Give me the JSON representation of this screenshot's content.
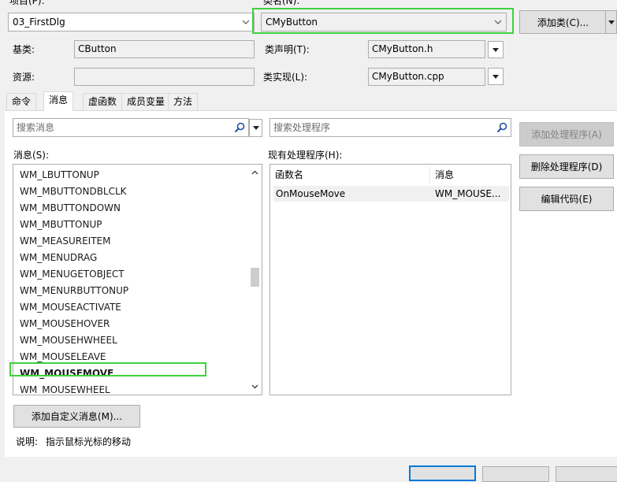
{
  "top": {
    "project_label": "项目(P):",
    "project_value": "03_FirstDlg",
    "class_name_label": "类名(N):",
    "class_name_value": "CMyButton",
    "add_class_label": "添加类(C)...",
    "base_class_label": "基类:",
    "base_class_value": "CButton",
    "class_decl_label": "类声明(T):",
    "class_decl_value": "CMyButton.h",
    "resource_label": "资源:",
    "resource_value": "",
    "class_impl_label": "类实现(L):",
    "class_impl_value": "CMyButton.cpp"
  },
  "tabs": [
    {
      "label": "命令"
    },
    {
      "label": "消息",
      "active": true
    },
    {
      "label": "虚函数"
    },
    {
      "label": "成员变量"
    },
    {
      "label": "方法"
    }
  ],
  "messages_panel": {
    "search_placeholder": "搜索消息",
    "list_label": "消息(S):",
    "items": [
      "WM_LBUTTONUP",
      "WM_MBUTTONDBLCLK",
      "WM_MBUTTONDOWN",
      "WM_MBUTTONUP",
      "WM_MEASUREITEM",
      "WM_MENUDRAG",
      "WM_MENUGETOBJECT",
      "WM_MENURBUTTONUP",
      "WM_MOUSEACTIVATE",
      "WM_MOUSEHOVER",
      "WM_MOUSEHWHEEL",
      "WM_MOUSELEAVE",
      "WM_MOUSEMOVE",
      "WM_MOUSEWHEEL"
    ],
    "selected_item": "WM_MOUSEMOVE",
    "add_custom_label": "添加自定义消息(M)..."
  },
  "handlers_panel": {
    "search_placeholder": "搜索处理程序",
    "list_label": "现有处理程序(H):",
    "columns": [
      "函数名",
      "消息"
    ],
    "rows": [
      [
        "OnMouseMove",
        "WM_MOUSE..."
      ]
    ]
  },
  "actions": {
    "add_handler": "添加处理程序(A)",
    "delete_handler": "删除处理程序(D)",
    "edit_code": "编辑代码(E)"
  },
  "description": {
    "label": "说明:",
    "text": "指示鼠标光标的移动"
  },
  "colors": {
    "highlight_border": "#3fd13f",
    "selected_row": "#f0f0f0",
    "primary_button_border": "#0078d7"
  }
}
